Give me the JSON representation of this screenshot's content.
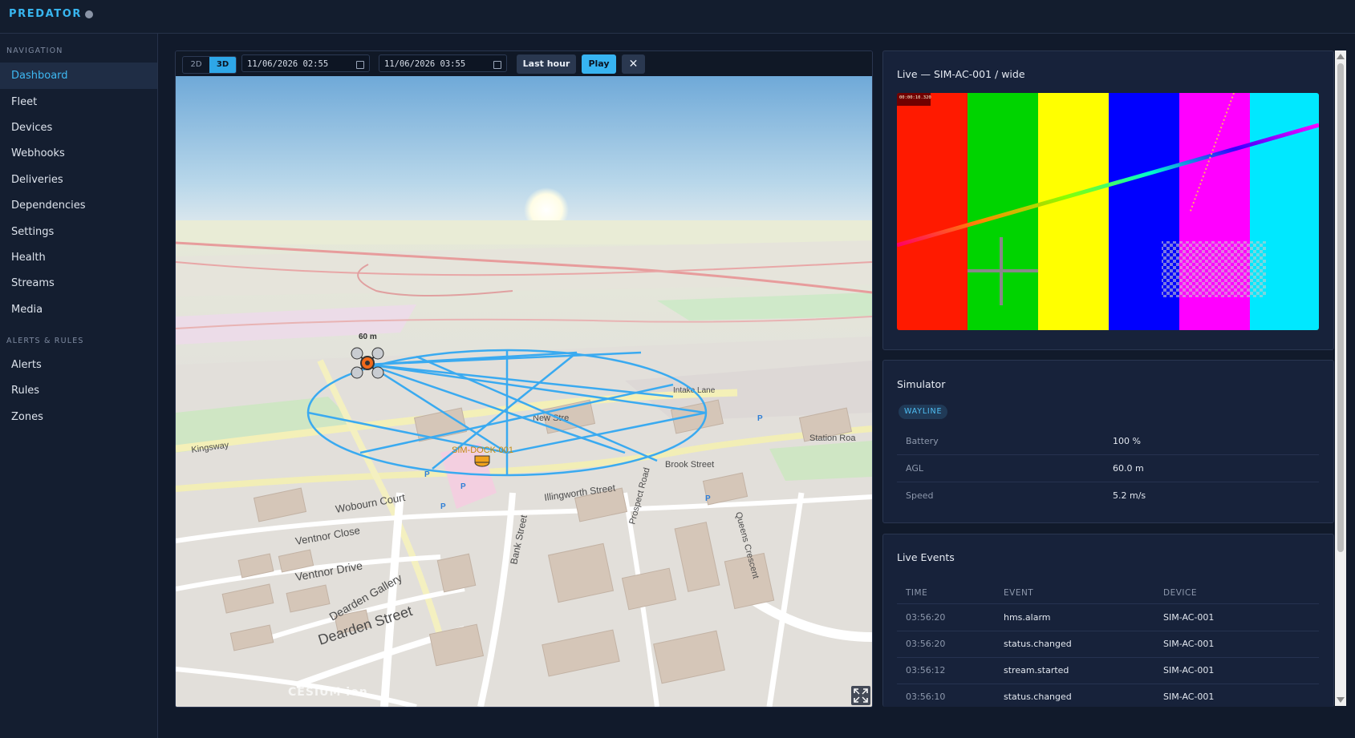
{
  "app": {
    "brand": "PREDATOR"
  },
  "sidebar": {
    "sections": [
      {
        "title": "NAVIGATION",
        "items": [
          "Dashboard",
          "Fleet",
          "Devices",
          "Webhooks",
          "Deliveries",
          "Dependencies",
          "Settings",
          "Health",
          "Streams",
          "Media"
        ]
      },
      {
        "title": "ALERTS & RULES",
        "items": [
          "Alerts",
          "Rules",
          "Zones"
        ]
      }
    ],
    "active": "Dashboard"
  },
  "map": {
    "mode_2d": "2D",
    "mode_3d": "3D",
    "selected_mode": "3D",
    "start_datetime": "11/06/2026 02:55",
    "end_datetime": "11/06/2026 03:55",
    "last_hour_label": "Last hour",
    "play_label": "Play",
    "close_label": "✕",
    "altitude_label": "60 m",
    "dock_label": "SIM-DOCK-001",
    "credit": "CESIUM ion",
    "streets": [
      "New Stre",
      "Kingsway",
      "Station Roa",
      "Brook Street",
      "Illingworth Street",
      "Wobourn Court",
      "Ventnor Close",
      "Ventnor Drive",
      "Dearden Street",
      "Dearden Gallery",
      "Bank Street",
      "Queens Crescent",
      "Prospect Road",
      "Intake Lane"
    ]
  },
  "live": {
    "title": "Live — SIM-AC-001 / wide",
    "colors": [
      "#ff1a00",
      "#00d400",
      "#ffff00",
      "#0000ff",
      "#ff00ff",
      "#00e8ff"
    ],
    "overlay_text": "00:00:10.320"
  },
  "simulator": {
    "title": "Simulator",
    "badge": "WAYLINE",
    "rows": [
      {
        "key": "Battery",
        "value": "100 %"
      },
      {
        "key": "AGL",
        "value": "60.0 m"
      },
      {
        "key": "Speed",
        "value": "5.2 m/s"
      }
    ]
  },
  "events": {
    "title": "Live Events",
    "columns": [
      "TIME",
      "EVENT",
      "DEVICE"
    ],
    "rows": [
      {
        "time": "03:56:20",
        "event": "hms.alarm",
        "device": "SIM-AC-001"
      },
      {
        "time": "03:56:20",
        "event": "status.changed",
        "device": "SIM-AC-001"
      },
      {
        "time": "03:56:12",
        "event": "stream.started",
        "device": "SIM-AC-001"
      },
      {
        "time": "03:56:10",
        "event": "status.changed",
        "device": "SIM-AC-001"
      }
    ]
  }
}
